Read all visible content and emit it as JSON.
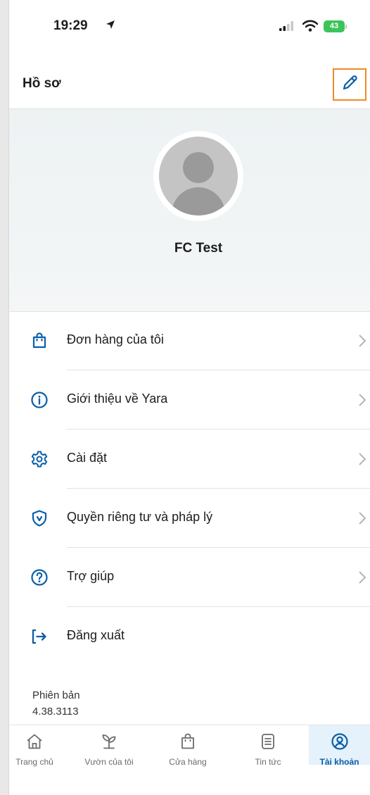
{
  "status_bar": {
    "time": "19:29",
    "battery": "43"
  },
  "header": {
    "title": "Hồ sơ",
    "edit_icon": "pencil-icon"
  },
  "profile": {
    "name": "FC Test"
  },
  "menu": {
    "items": [
      {
        "label": "Đơn hàng của tôi",
        "icon": "shopping-bag-icon"
      },
      {
        "label": "Giới thiệu về Yara",
        "icon": "info-icon"
      },
      {
        "label": "Cài đặt",
        "icon": "gear-icon"
      },
      {
        "label": "Quyền riêng tư và pháp lý",
        "icon": "shield-icon"
      },
      {
        "label": "Trợ giúp",
        "icon": "help-icon"
      }
    ],
    "logout": {
      "label": "Đăng xuất",
      "icon": "logout-icon"
    }
  },
  "version": {
    "label": "Phiên bản",
    "number": "4.38.3113"
  },
  "tabbar": {
    "tabs": [
      {
        "label": "Trang chủ",
        "icon": "home-icon"
      },
      {
        "label": "Vườn của tôi",
        "icon": "plant-icon"
      },
      {
        "label": "Cửa hàng",
        "icon": "shopping-bag-icon"
      },
      {
        "label": "Tin tức",
        "icon": "news-icon"
      },
      {
        "label": "Tài khoản",
        "icon": "account-icon",
        "active": true
      }
    ]
  },
  "colors": {
    "accent": "#0a5fa8",
    "highlight": "#f08a24",
    "battery": "#3cc45a"
  }
}
